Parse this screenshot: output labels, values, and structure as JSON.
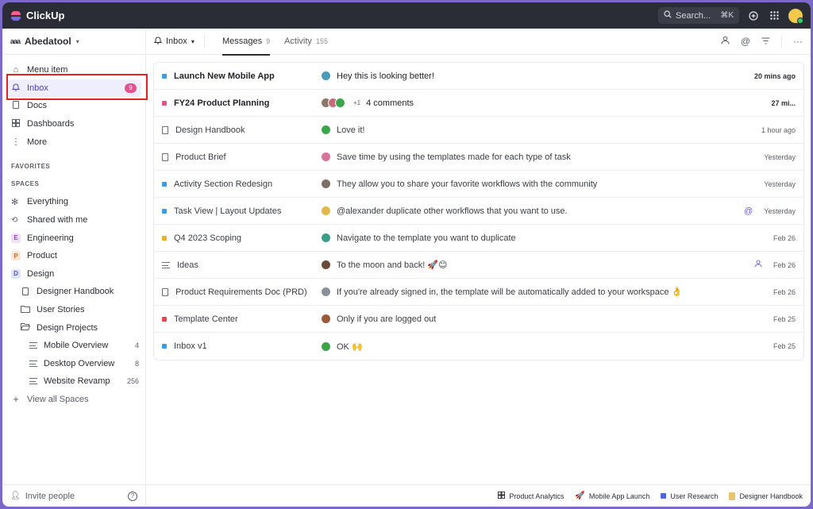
{
  "app": {
    "name": "ClickUp"
  },
  "topbar": {
    "search_placeholder": "Search...",
    "shortcut": "⌘K"
  },
  "workspace": {
    "logo": "aaa",
    "name": "Abedatool"
  },
  "nav": [
    {
      "label": "Menu item",
      "icon": "home-icon"
    },
    {
      "label": "Inbox",
      "icon": "bell-icon",
      "badge": "9"
    },
    {
      "label": "Docs",
      "icon": "doc-icon"
    },
    {
      "label": "Dashboards",
      "icon": "dashboard-icon"
    },
    {
      "label": "More",
      "icon": "more-vertical-icon"
    }
  ],
  "sections": {
    "favorites": "FAVORITES",
    "spaces": "SPACES"
  },
  "spaces": [
    {
      "label": "Everything",
      "icon": "everything-icon"
    },
    {
      "label": "Shared with me",
      "icon": "share-icon"
    },
    {
      "label": "Engineering",
      "letter": "E",
      "color": "#c08fd8"
    },
    {
      "label": "Product",
      "letter": "P",
      "color": "#f5a97f"
    },
    {
      "label": "Design",
      "letter": "D",
      "color": "#9fa8e8"
    }
  ],
  "design_children": [
    {
      "label": "Designer Handbook"
    },
    {
      "label": "User Stories"
    },
    {
      "label": "Design  Projects"
    }
  ],
  "project_lists": [
    {
      "label": "Mobile Overview",
      "count": "4"
    },
    {
      "label": "Desktop Overview",
      "count": "8"
    },
    {
      "label": "Website Revamp",
      "count": "256"
    }
  ],
  "view_all": "View all Spaces",
  "footer": {
    "invite": "Invite people",
    "help": "?"
  },
  "header": {
    "inbox_label": "Inbox",
    "tabs": [
      {
        "label": "Messages",
        "count": "9"
      },
      {
        "label": "Activity",
        "count": "155"
      }
    ]
  },
  "rows": [
    {
      "title": "Launch New Mobile App",
      "msg": "Hey this is looking better!",
      "time": "20 mins ago",
      "unread": true,
      "marker": "#3b9de8"
    },
    {
      "title": "FY24 Product Planning",
      "msg": "4 comments",
      "time": "27 mi...",
      "unread": true,
      "marker": "#e5508f",
      "extra": "+1"
    },
    {
      "title": "Design Handbook",
      "msg": "Love it!",
      "time": "1 hour ago"
    },
    {
      "title": "Product Brief",
      "msg": "Save time by using the templates made for each type of task",
      "time": "Yesterday"
    },
    {
      "title": "Activity Section Redesign",
      "msg": "They allow you to share your favorite workflows with the community",
      "time": "Yesterday",
      "marker": "#3b9de8"
    },
    {
      "title": "Task View | Layout Updates",
      "msg": "@alexander duplicate other workflows that you want to use.",
      "time": "Yesterday",
      "marker": "#3b9de8",
      "meta": "@"
    },
    {
      "title": "Q4 2023 Scoping",
      "msg": "Navigate to the template you want to duplicate",
      "time": "Feb 26",
      "marker": "#f2b01e"
    },
    {
      "title": "Ideas",
      "msg": "To the moon and back! 🚀😊",
      "time": "Feb 26",
      "meta": "person"
    },
    {
      "title": "Product Requirements Doc (PRD)",
      "msg": "If you're already signed in, the template will be automatically added to your workspace 👌",
      "time": "Feb 26"
    },
    {
      "title": "Template Center",
      "msg": "Only if you are logged out",
      "time": "Feb 25",
      "marker": "#e5484d"
    },
    {
      "title": "Inbox v1",
      "msg": "OK 🙌",
      "time": "Feb 25",
      "marker": "#3b9de8"
    }
  ],
  "bottom_bar": [
    {
      "label": "Product Analytics",
      "icon": "grid-icon"
    },
    {
      "label": "Mobile App Launch",
      "icon": "rocket-icon"
    },
    {
      "label": "User Research",
      "icon": "square-icon",
      "color": "#4d66e0"
    },
    {
      "label": "Designer Handbook",
      "icon": "notebook-icon"
    }
  ]
}
